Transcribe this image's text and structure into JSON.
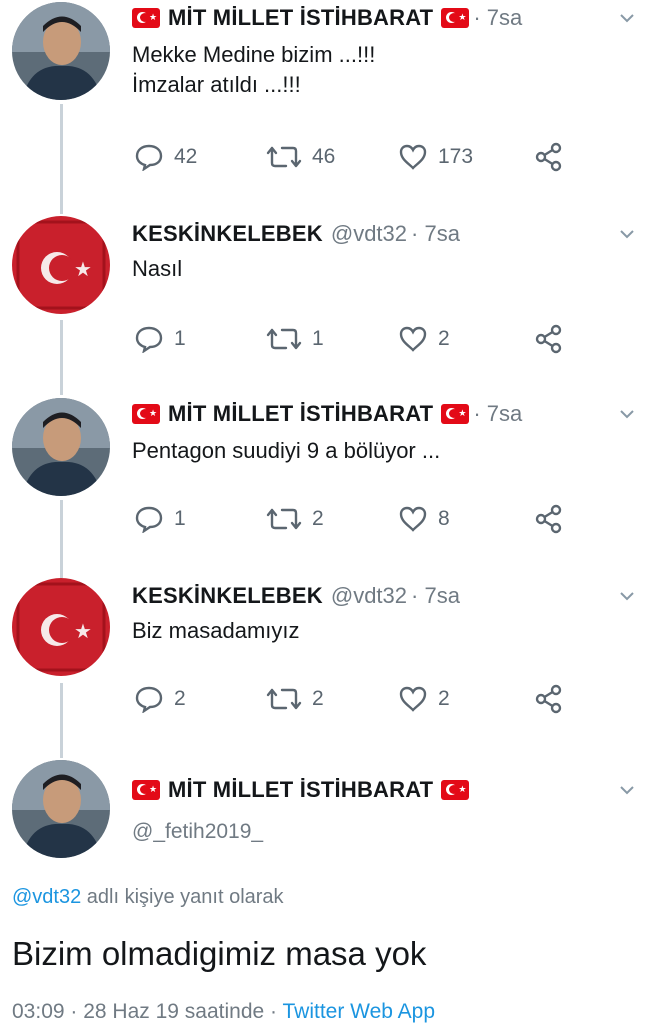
{
  "tweets": [
    {
      "name": "MİT MİLLET İSTİHBARAT",
      "handle": "",
      "time": "· 7sa",
      "text_lines": [
        "Mekke Medine bizim ...!!!",
        "İmzalar atıldı ...!!!"
      ],
      "replies": "42",
      "retweets": "46",
      "likes": "173"
    },
    {
      "name": "KESKİNKELEBEK",
      "handle": "@vdt32",
      "time": "· 7sa",
      "text_lines": [
        "Nasıl"
      ],
      "replies": "1",
      "retweets": "1",
      "likes": "2"
    },
    {
      "name": "MİT MİLLET İSTİHBARAT",
      "handle": "",
      "time": "· 7sa",
      "text_lines": [
        "Pentagon suudiyi 9 a bölüyor ..."
      ],
      "replies": "1",
      "retweets": "2",
      "likes": "8"
    },
    {
      "name": "KESKİNKELEBEK",
      "handle": "@vdt32",
      "time": "· 7sa",
      "text_lines": [
        "Biz masadamıyız"
      ],
      "replies": "2",
      "retweets": "2",
      "likes": "2"
    }
  ],
  "main_tweet": {
    "name": "MİT MİLLET İSTİHBARAT",
    "handle": "@_fetih2019_",
    "reply_to_mention": "@vdt32",
    "reply_to_suffix": " adlı kişiye yanıt olarak",
    "text": "Bizim olmadigimiz masa yok",
    "time": "03:09",
    "date": "· 28 Haz 19 saatinde ·",
    "app": "Twitter Web App"
  },
  "icons": {
    "reply": "reply-bubble-icon",
    "retweet": "retweet-icon",
    "like": "heart-icon",
    "share": "share-icon",
    "more": "chevron-down-icon",
    "flag": "turkish-flag-icon"
  },
  "colors": {
    "link": "#1b95e0",
    "muted": "#707a83",
    "flag_red": "#e30a17",
    "thread_line": "#c9d2d9"
  }
}
